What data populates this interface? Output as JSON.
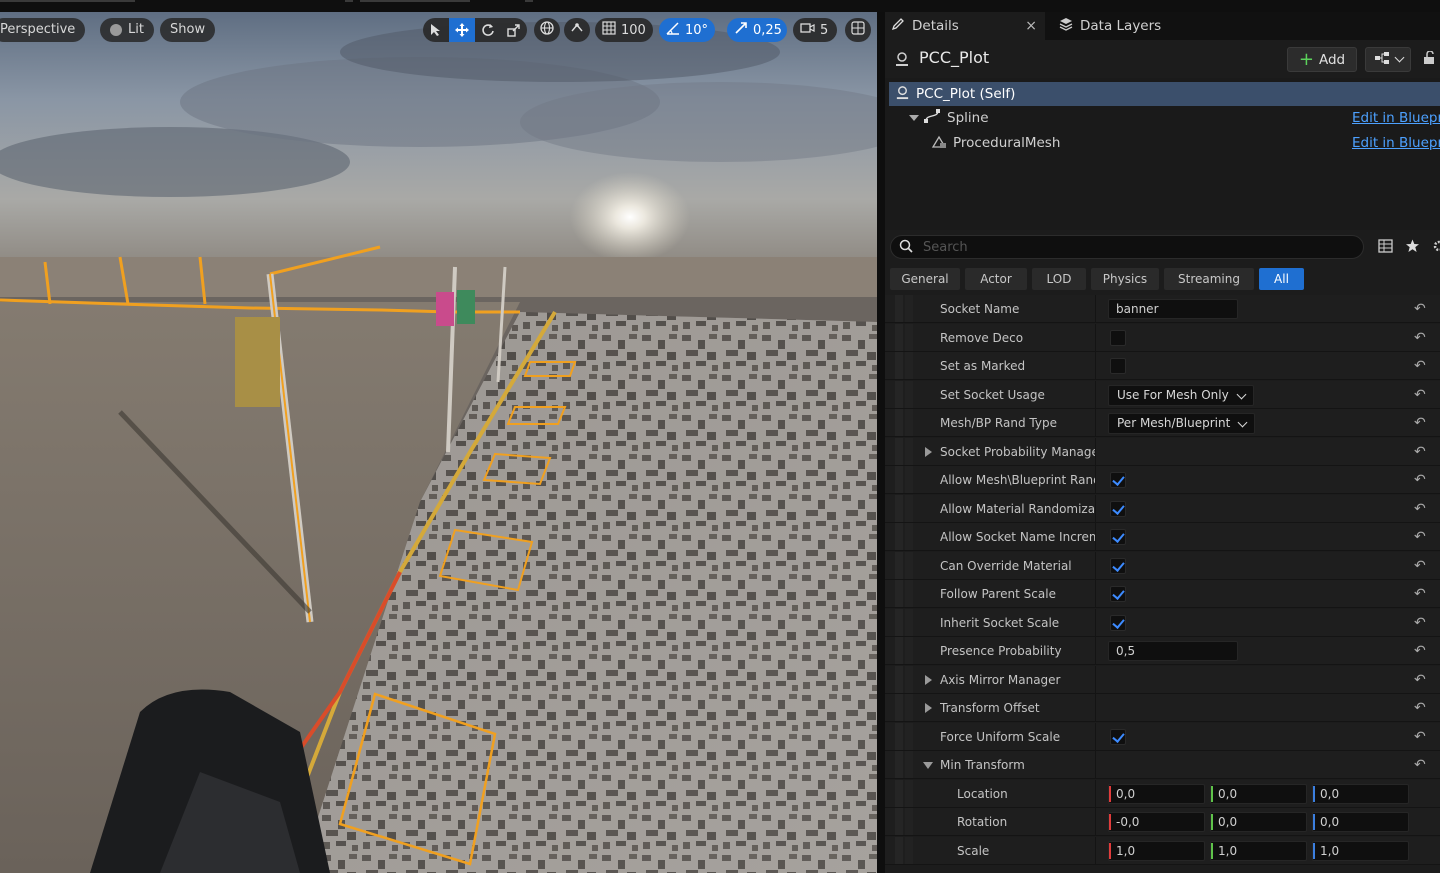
{
  "viewport": {
    "perspective_label": "Perspective",
    "lit_label": "Lit",
    "show_label": "Show",
    "grid_snap_value": "100",
    "rotation_snap_value": "10°",
    "scale_snap_value": "0,25",
    "camera_speed_value": "5"
  },
  "panel": {
    "tab_details": "Details",
    "tab_close": "×",
    "tab_data_layers": "Data Layers",
    "actor_name": "PCC_Plot",
    "add_label": "Add",
    "components": [
      {
        "label": "PCC_Plot (Self)"
      },
      {
        "label": "Spline",
        "link": "Edit in Blueprint"
      },
      {
        "label": "ProceduralMesh",
        "link": "Edit in Blueprint"
      }
    ],
    "search_placeholder": "Search",
    "filters": [
      "General",
      "Actor",
      "LOD",
      "Physics",
      "Streaming",
      "All"
    ],
    "active_filter": "All"
  },
  "properties": {
    "socket_name": {
      "label": "Socket Name",
      "value": "banner"
    },
    "remove_deco": {
      "label": "Remove Deco",
      "checked": false
    },
    "set_as_marked": {
      "label": "Set as Marked",
      "checked": false
    },
    "set_socket_usage": {
      "label": "Set Socket Usage",
      "value": "Use For Mesh Only"
    },
    "mesh_rand_type": {
      "label": "Mesh/BP Rand Type",
      "value": "Per Mesh/Blueprint"
    },
    "socket_probability_manager": {
      "label": "Socket Probability Manager"
    },
    "allow_mesh_rand": {
      "label": "Allow Mesh\\Blueprint Rand...",
      "checked": true
    },
    "allow_material_rand": {
      "label": "Allow Material Randomizati...",
      "checked": true
    },
    "allow_socket_name_incr": {
      "label": "Allow Socket Name Increm...",
      "checked": true
    },
    "can_override_material": {
      "label": "Can Override Material",
      "checked": true
    },
    "follow_parent_scale": {
      "label": "Follow Parent Scale",
      "checked": true
    },
    "inherit_socket_scale": {
      "label": "Inherit Socket Scale",
      "checked": true
    },
    "presence_probability": {
      "label": "Presence Probability",
      "value": "0,5"
    },
    "axis_mirror_manager": {
      "label": "Axis Mirror Manager"
    },
    "transform_offset": {
      "label": "Transform Offset"
    },
    "force_uniform_scale": {
      "label": "Force Uniform Scale",
      "checked": true
    },
    "min_transform": {
      "label": "Min Transform"
    },
    "location": {
      "label": "Location",
      "x": "0,0",
      "y": "0,0",
      "z": "0,0"
    },
    "rotation": {
      "label": "Rotation",
      "x": "-0,0",
      "y": "0,0",
      "z": "0,0"
    },
    "scale": {
      "label": "Scale",
      "x": "1,0",
      "y": "1,0",
      "z": "1,0"
    }
  },
  "colors": {
    "accent_blue": "#1f6fd1",
    "selection_row": "#3b4f6b",
    "link_blue": "#4da1ff",
    "check_blue": "#3d8bff",
    "axis_x": "#e03c3c",
    "axis_y": "#5fc34a",
    "axis_z": "#3b7fe0",
    "spline_orange": "#f0a020"
  }
}
